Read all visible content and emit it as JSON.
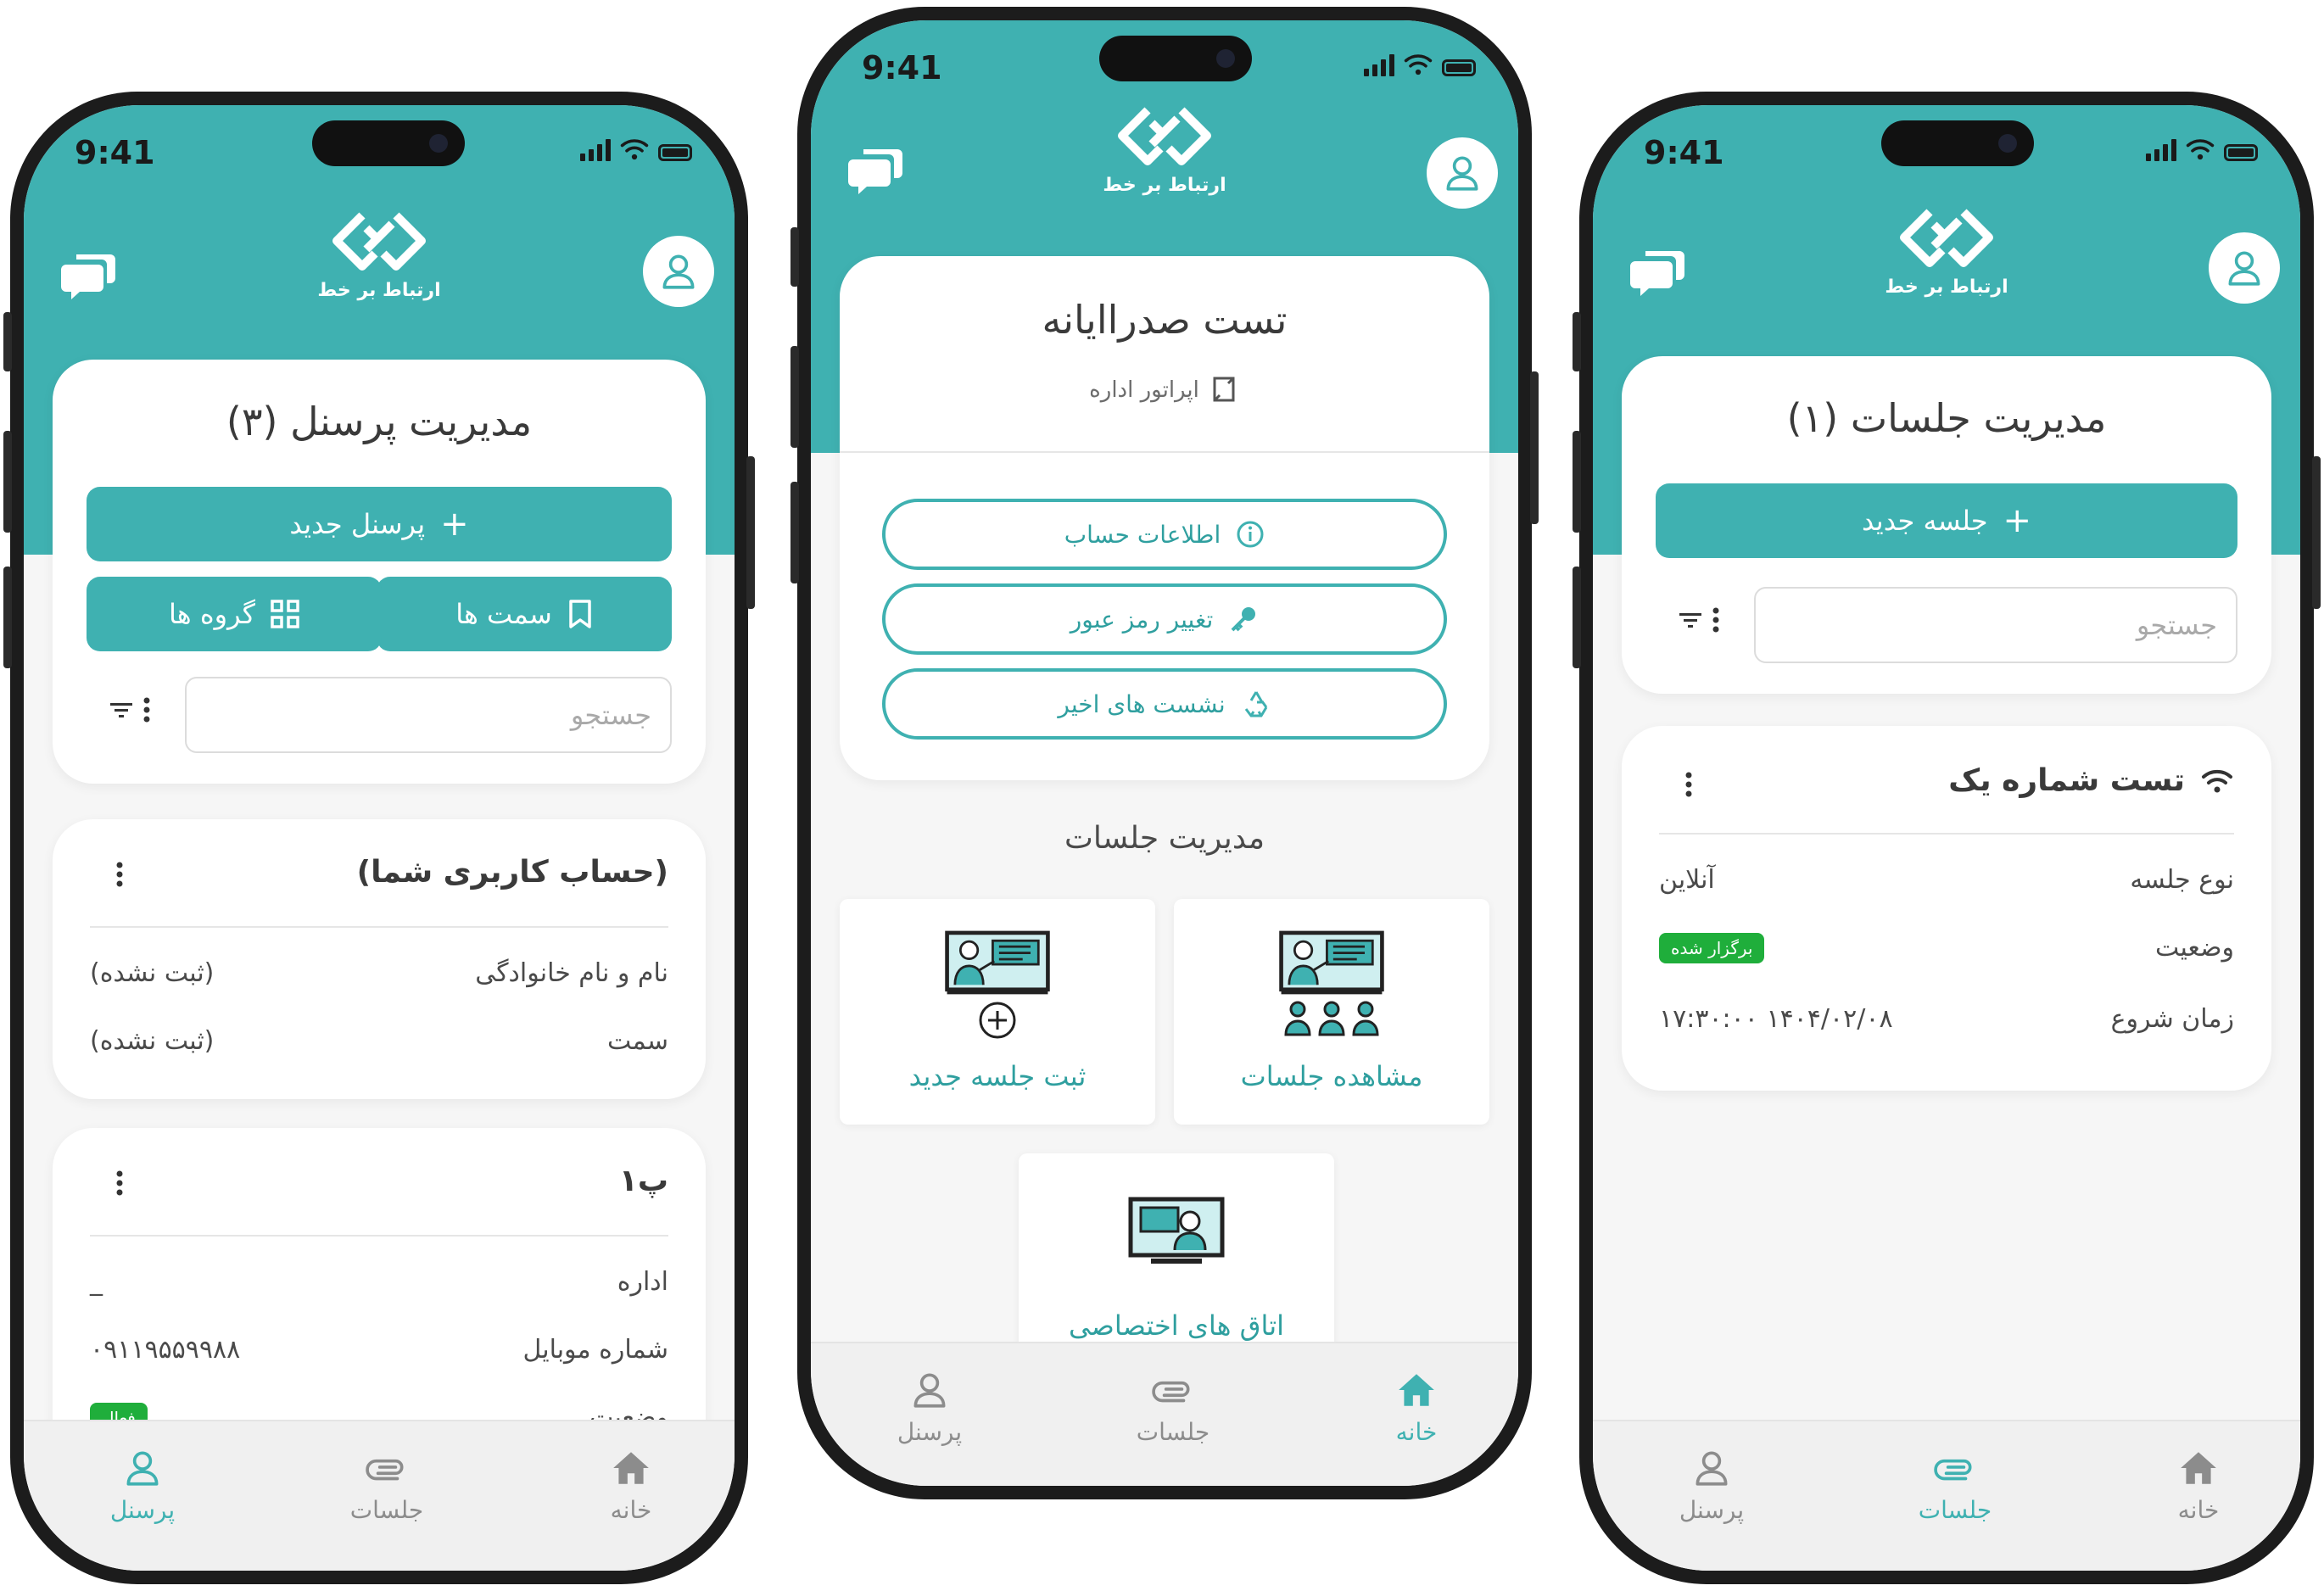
{
  "colors": {
    "teal": "#3fb1b1",
    "badge_green": "#1fae3b"
  },
  "status_bar": {
    "time": "9:41"
  },
  "brand": {
    "logo_text": "ارتباط بر خط"
  },
  "icons": [
    "chat-icon",
    "user-avatar-icon",
    "plus-icon",
    "grid-icon",
    "bookmark-icon",
    "filter-icon",
    "more-vertical-icon",
    "info-icon",
    "key-icon",
    "recycle-icon",
    "wifi-icon",
    "home-icon",
    "paperclip-icon",
    "user-icon"
  ],
  "phone_personnel": {
    "title": "مدیریت پرسنل (۳)",
    "new_button": "پرسنل جدید",
    "groups_button": "گروه ها",
    "positions_button": "سمت ها",
    "search_placeholder": "جستجو",
    "cards": [
      {
        "title": "(حساب کاربری شما)",
        "rows": [
          {
            "key": "نام و نام خانوادگی",
            "value": "(ثبت نشده)"
          },
          {
            "key": "سمت",
            "value": "(ثبت نشده)"
          }
        ]
      },
      {
        "title": "پ۱",
        "rows": [
          {
            "key": "اداره",
            "value": "_"
          },
          {
            "key": "شماره موبایل",
            "value": "۰۹۱۱۹۵۵۹۹۸۸"
          },
          {
            "key": "وضعیت",
            "value": "فعال"
          }
        ]
      }
    ],
    "tabs": {
      "personnel": "پرسنل",
      "sessions": "جلسات",
      "home": "خانه"
    }
  },
  "phone_home": {
    "user_name": "تست صدرا‌ایانه",
    "user_role": "اپراتور اداره",
    "account_info": "اطلاعات حساب",
    "change_password": "تغییر رمز عبور",
    "recent_sessions": "نشست های اخیر",
    "section_title": "مدیریت جلسات",
    "tile_new_session": "ثبت جلسه جدید",
    "tile_view_sessions": "مشاهده جلسات",
    "tile_private_rooms": "اتاق های اختصاصی",
    "tabs": {
      "personnel": "پرسنل",
      "sessions": "جلسات",
      "home": "خانه"
    }
  },
  "phone_sessions": {
    "title": "مدیریت جلسات (۱)",
    "new_button": "جلسه جدید",
    "search_placeholder": "جستجو",
    "card": {
      "title": "تست شماره یک",
      "rows": [
        {
          "key": "نوع جلسه",
          "value": "آنلاین"
        },
        {
          "key": "وضعیت",
          "value": "برگزار شده"
        },
        {
          "key": "زمان شروع",
          "value": "۱۴۰۴/۰۲/۰۸ ۱۷:۳۰:۰۰"
        }
      ]
    },
    "tabs": {
      "personnel": "پرسنل",
      "sessions": "جلسات",
      "home": "خانه"
    }
  }
}
